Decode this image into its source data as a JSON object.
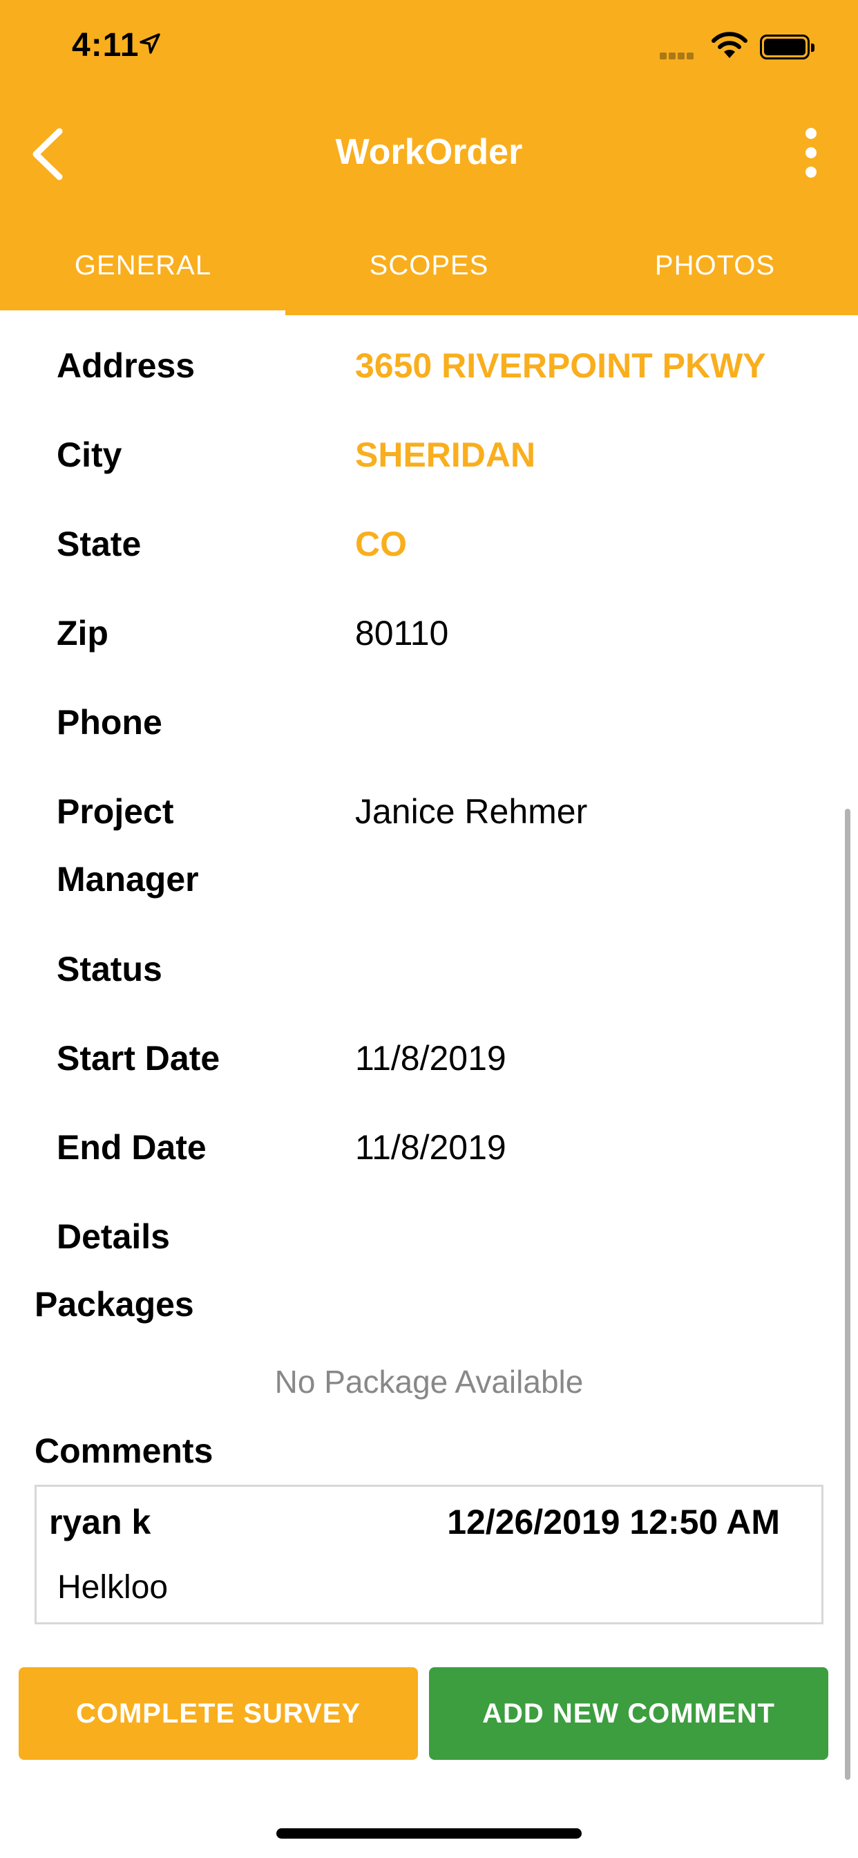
{
  "status_bar": {
    "time": "4:11"
  },
  "header": {
    "title": "WorkOrder",
    "background_color": "#F9AE1D"
  },
  "tabs": [
    {
      "label": "GENERAL",
      "active": true
    },
    {
      "label": "SCOPES",
      "active": false
    },
    {
      "label": "PHOTOS",
      "active": false
    }
  ],
  "fields": [
    {
      "label": "Address",
      "value": "3650 RIVERPOINT PKWY",
      "link": true
    },
    {
      "label": "City",
      "value": "SHERIDAN",
      "link": true
    },
    {
      "label": "State",
      "value": "CO",
      "link": true
    },
    {
      "label": "Zip",
      "value": "80110"
    },
    {
      "label": "Phone",
      "value": ""
    },
    {
      "label": "Project\nManager",
      "value": "Janice Rehmer"
    },
    {
      "label": "Status",
      "value": ""
    },
    {
      "label": "Start Date",
      "value": "11/8/2019"
    },
    {
      "label": "End Date",
      "value": "11/8/2019"
    },
    {
      "label": "Details",
      "value": ""
    }
  ],
  "packages": {
    "title": "Packages",
    "empty_text": "No Package Available"
  },
  "comments": {
    "title": "Comments",
    "items": [
      {
        "author": "ryan k",
        "date": "12/26/2019 12:50 AM",
        "text": "Helkloo"
      }
    ]
  },
  "buttons": {
    "complete_survey": "COMPLETE SURVEY",
    "add_comment": "ADD NEW COMMENT"
  },
  "colors": {
    "accent": "#F9AE1D",
    "success": "#3C9E3F"
  }
}
